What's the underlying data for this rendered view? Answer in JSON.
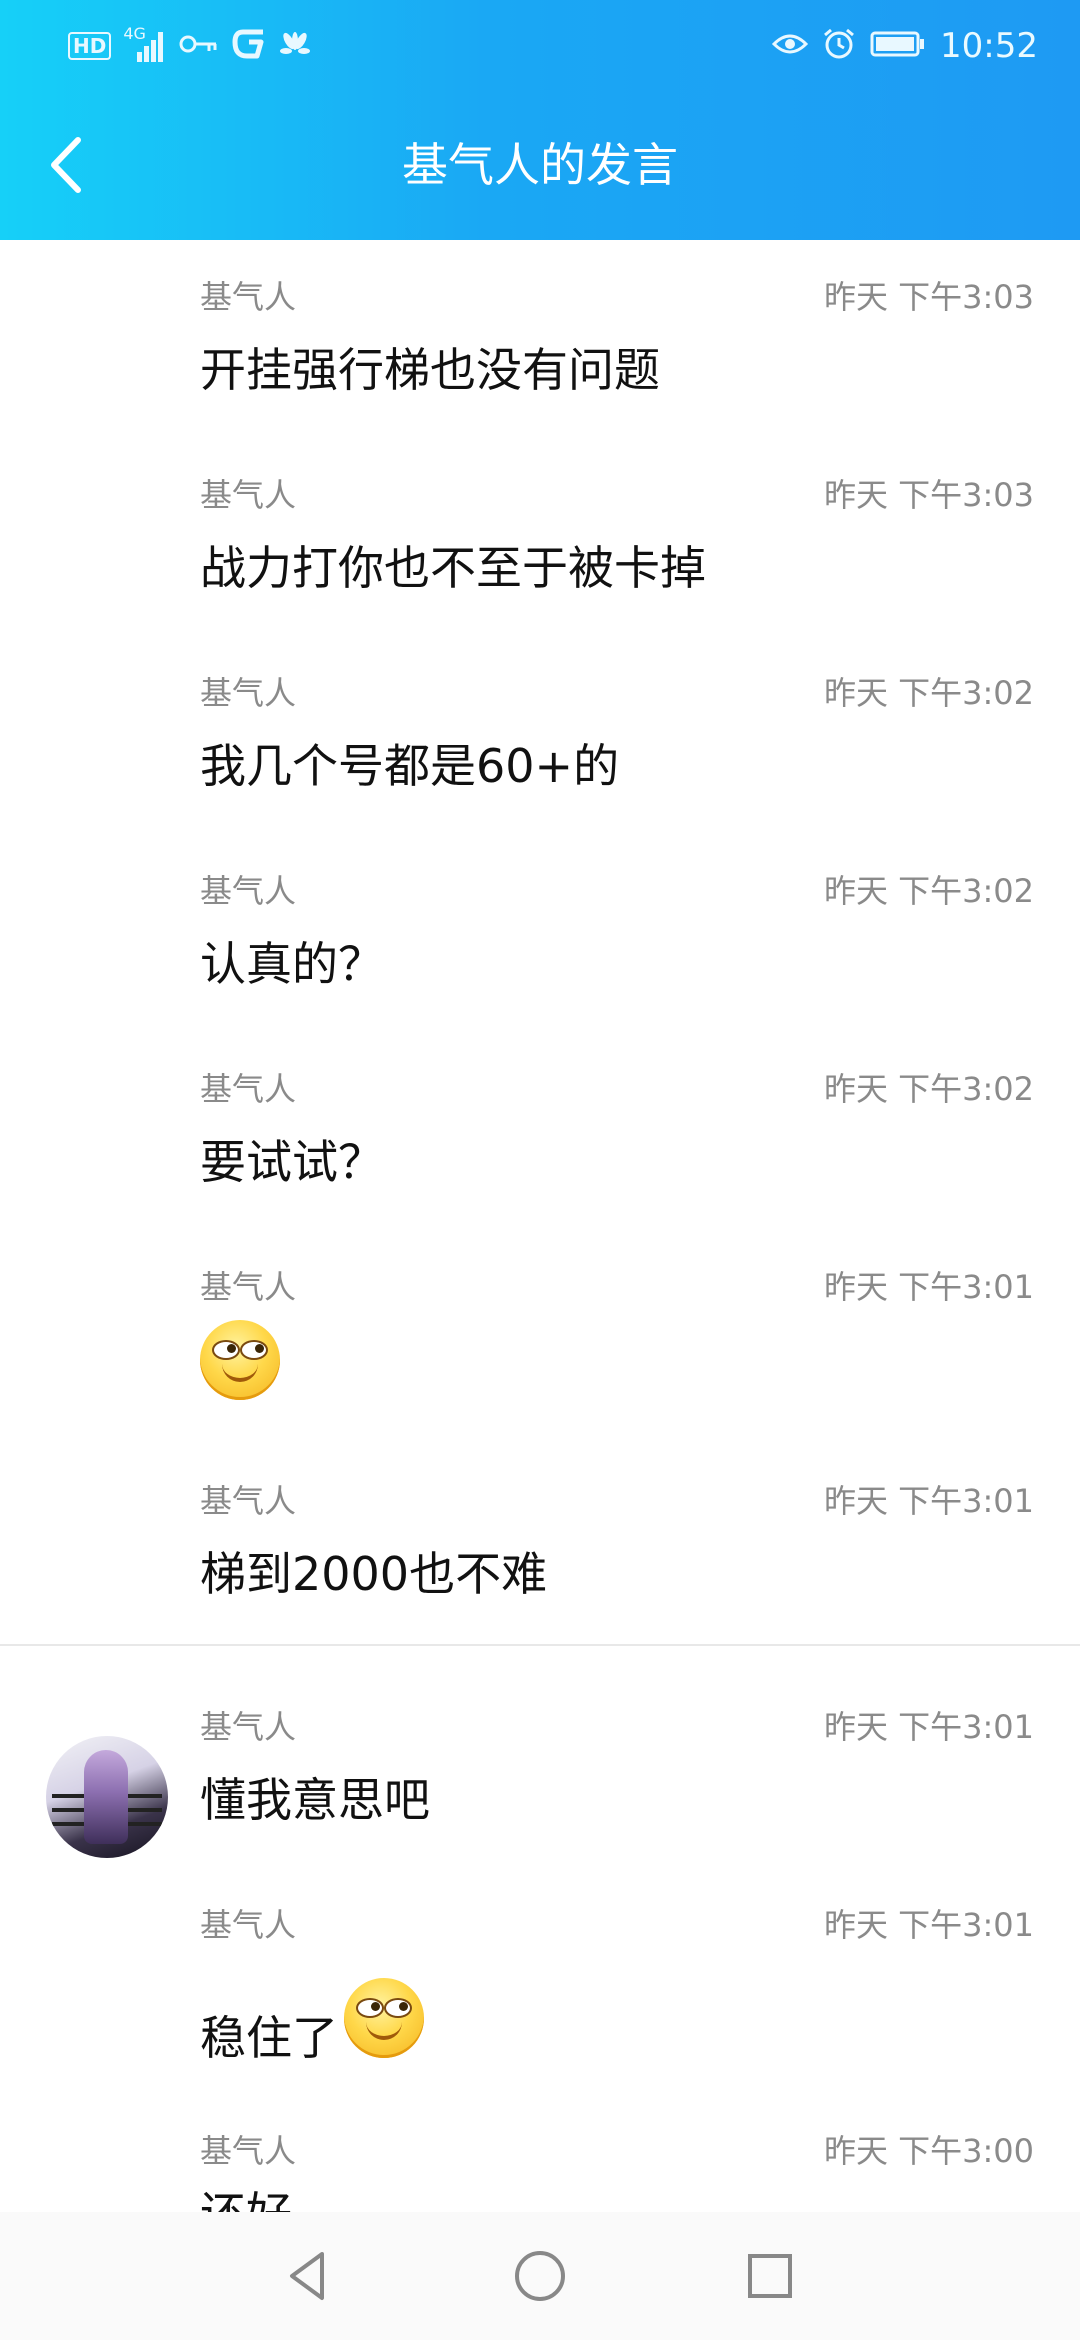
{
  "status_bar": {
    "left_badge": "HD",
    "network": "4G",
    "time": "10:52"
  },
  "header": {
    "title": "基气人的发言"
  },
  "messages": [
    {
      "sender": "基气人",
      "time": "昨天 下午3:03",
      "text": "开挂强行梯也没有问题"
    },
    {
      "sender": "基气人",
      "time": "昨天 下午3:03",
      "text": "战力打你也不至于被卡掉"
    },
    {
      "sender": "基气人",
      "time": "昨天 下午3:02",
      "text": "我几个号都是60+的"
    },
    {
      "sender": "基气人",
      "time": "昨天 下午3:02",
      "text": "认真的？"
    },
    {
      "sender": "基气人",
      "time": "昨天 下午3:02",
      "text": "要试试？"
    },
    {
      "sender": "基气人",
      "time": "昨天 下午3:01",
      "text": ""
    },
    {
      "sender": "基气人",
      "time": "昨天 下午3:01",
      "text": "梯到2000也不难"
    },
    {
      "sender": "基气人",
      "time": "昨天 下午3:01",
      "text": "懂我意思吧"
    },
    {
      "sender": "基气人",
      "time": "昨天 下午3:01",
      "text": "稳住了"
    },
    {
      "sender": "基气人",
      "time": "昨天 下午3:00",
      "text": "还好"
    }
  ],
  "colors": {
    "header_start": "#16d0f8",
    "header_end": "#1e9af3",
    "meta_text": "#8a8a8a",
    "divider": "#e8e8e8"
  },
  "icons": {
    "back": "chevron-left-icon",
    "emoji": "smirk-emoji-icon",
    "nav_back": "triangle-back-icon",
    "nav_home": "circle-home-icon",
    "nav_recents": "square-recents-icon"
  }
}
